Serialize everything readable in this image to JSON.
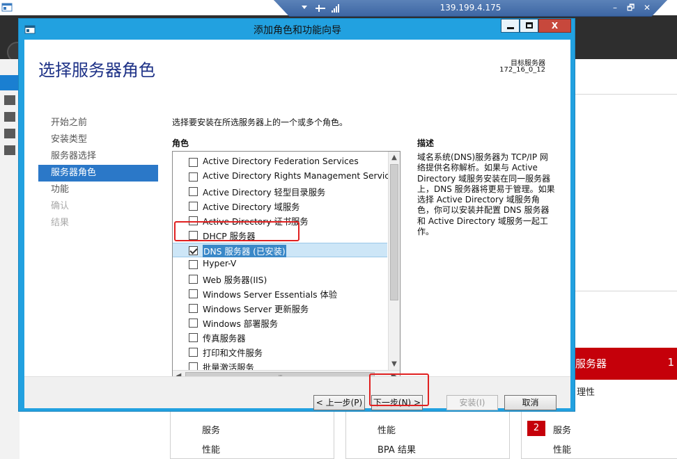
{
  "remote_bar": {
    "ip": "139.199.4.175",
    "minimize_symbol": "–",
    "restore_symbol": "🗗",
    "close_symbol": "✕"
  },
  "wizard": {
    "title": "添加角色和功能向导",
    "help_symbol": "",
    "minimize_symbol": "–",
    "maximize_symbol": "□",
    "close_symbol": "X",
    "heading": "选择服务器角色",
    "target_label": "目标服务器",
    "target_value": "172_16_0_12",
    "nav": [
      {
        "label": "开始之前",
        "state": "normal"
      },
      {
        "label": "安装类型",
        "state": "normal"
      },
      {
        "label": "服务器选择",
        "state": "normal"
      },
      {
        "label": "服务器角色",
        "state": "active"
      },
      {
        "label": "功能",
        "state": "normal"
      },
      {
        "label": "确认",
        "state": "disabled"
      },
      {
        "label": "结果",
        "state": "disabled"
      }
    ],
    "instruction": "选择要安装在所选服务器上的一个或多个角色。",
    "roles_label": "角色",
    "description_label": "描述",
    "description_text": "域名系统(DNS)服务器为 TCP/IP 网络提供名称解析。如果与 Active Directory 域服务安装在同一服务器上，DNS 服务器将更易于管理。如果选择 Active Directory 域服务角色，你可以安装并配置 DNS 服务器和 Active Directory 域服务一起工作。",
    "roles": [
      {
        "label": "Active Directory Federation Services",
        "checked": false,
        "selected": false
      },
      {
        "label": "Active Directory Rights Management Services",
        "checked": false,
        "selected": false
      },
      {
        "label": "Active Directory 轻型目录服务",
        "checked": false,
        "selected": false
      },
      {
        "label": "Active Directory 域服务",
        "checked": false,
        "selected": false
      },
      {
        "label": "Active Directory 证书服务",
        "checked": false,
        "selected": false
      },
      {
        "label": "DHCP 服务器",
        "checked": false,
        "selected": false
      },
      {
        "label": "DNS 服务器 (已安装)",
        "checked": true,
        "selected": true
      },
      {
        "label": "Hyper-V",
        "checked": false,
        "selected": false
      },
      {
        "label": "Web 服务器(IIS)",
        "checked": false,
        "selected": false
      },
      {
        "label": "Windows Server Essentials 体验",
        "checked": false,
        "selected": false
      },
      {
        "label": "Windows Server 更新服务",
        "checked": false,
        "selected": false
      },
      {
        "label": "Windows 部署服务",
        "checked": false,
        "selected": false
      },
      {
        "label": "传真服务器",
        "checked": false,
        "selected": false
      },
      {
        "label": "打印和文件服务",
        "checked": false,
        "selected": false
      },
      {
        "label": "批量激活服务",
        "checked": false,
        "selected": false
      }
    ],
    "buttons": {
      "prev": "< 上一步(P)",
      "next": "下一步(N) >",
      "install": "安装(I)",
      "cancel": "取消"
    }
  },
  "background": {
    "red_tile_title": "服务器",
    "red_tile_count": "1",
    "manageability_fragment": "理性",
    "tile_services_1": "服务",
    "tile_performance_1": "性能",
    "tile_performance_2": "性能",
    "tile_bpa": "BPA 结果",
    "tile_badge": "2",
    "tile_services_3": "服务",
    "tile_performance_3": "性能"
  },
  "colors": {
    "wizard_frame": "#22a1e0",
    "heading": "#1e3287",
    "nav_active": "#2b78c8",
    "alert_red": "#c5000a",
    "annotation_red": "#e02020"
  }
}
